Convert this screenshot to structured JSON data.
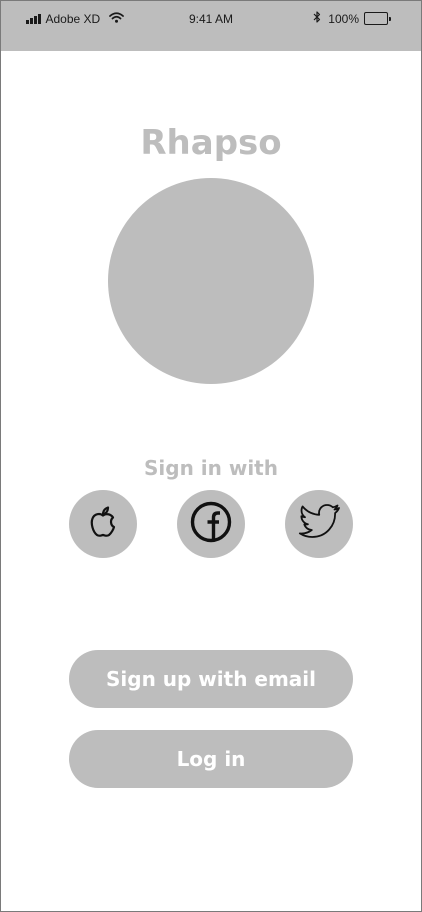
{
  "status_bar": {
    "carrier": "Adobe XD",
    "time": "9:41 AM",
    "battery": "100%",
    "battery_level": 1.0,
    "icons": [
      "signal-icon",
      "wifi-icon",
      "bluetooth-icon",
      "battery-icon"
    ]
  },
  "app": {
    "title": "Rhapso"
  },
  "signin": {
    "label": "Sign in with",
    "providers": [
      {
        "name": "Apple",
        "icon": "apple-icon"
      },
      {
        "name": "Facebook",
        "icon": "facebook-icon"
      },
      {
        "name": "Twitter",
        "icon": "twitter-icon"
      }
    ]
  },
  "actions": {
    "signup_label": "Sign up with email",
    "login_label": "Log in"
  },
  "colors": {
    "placeholder_gray": "#bdbdbd",
    "status_bar_bg": "#bdbdbd",
    "text_dark": "#1a1a1a",
    "button_text": "#ffffff"
  }
}
